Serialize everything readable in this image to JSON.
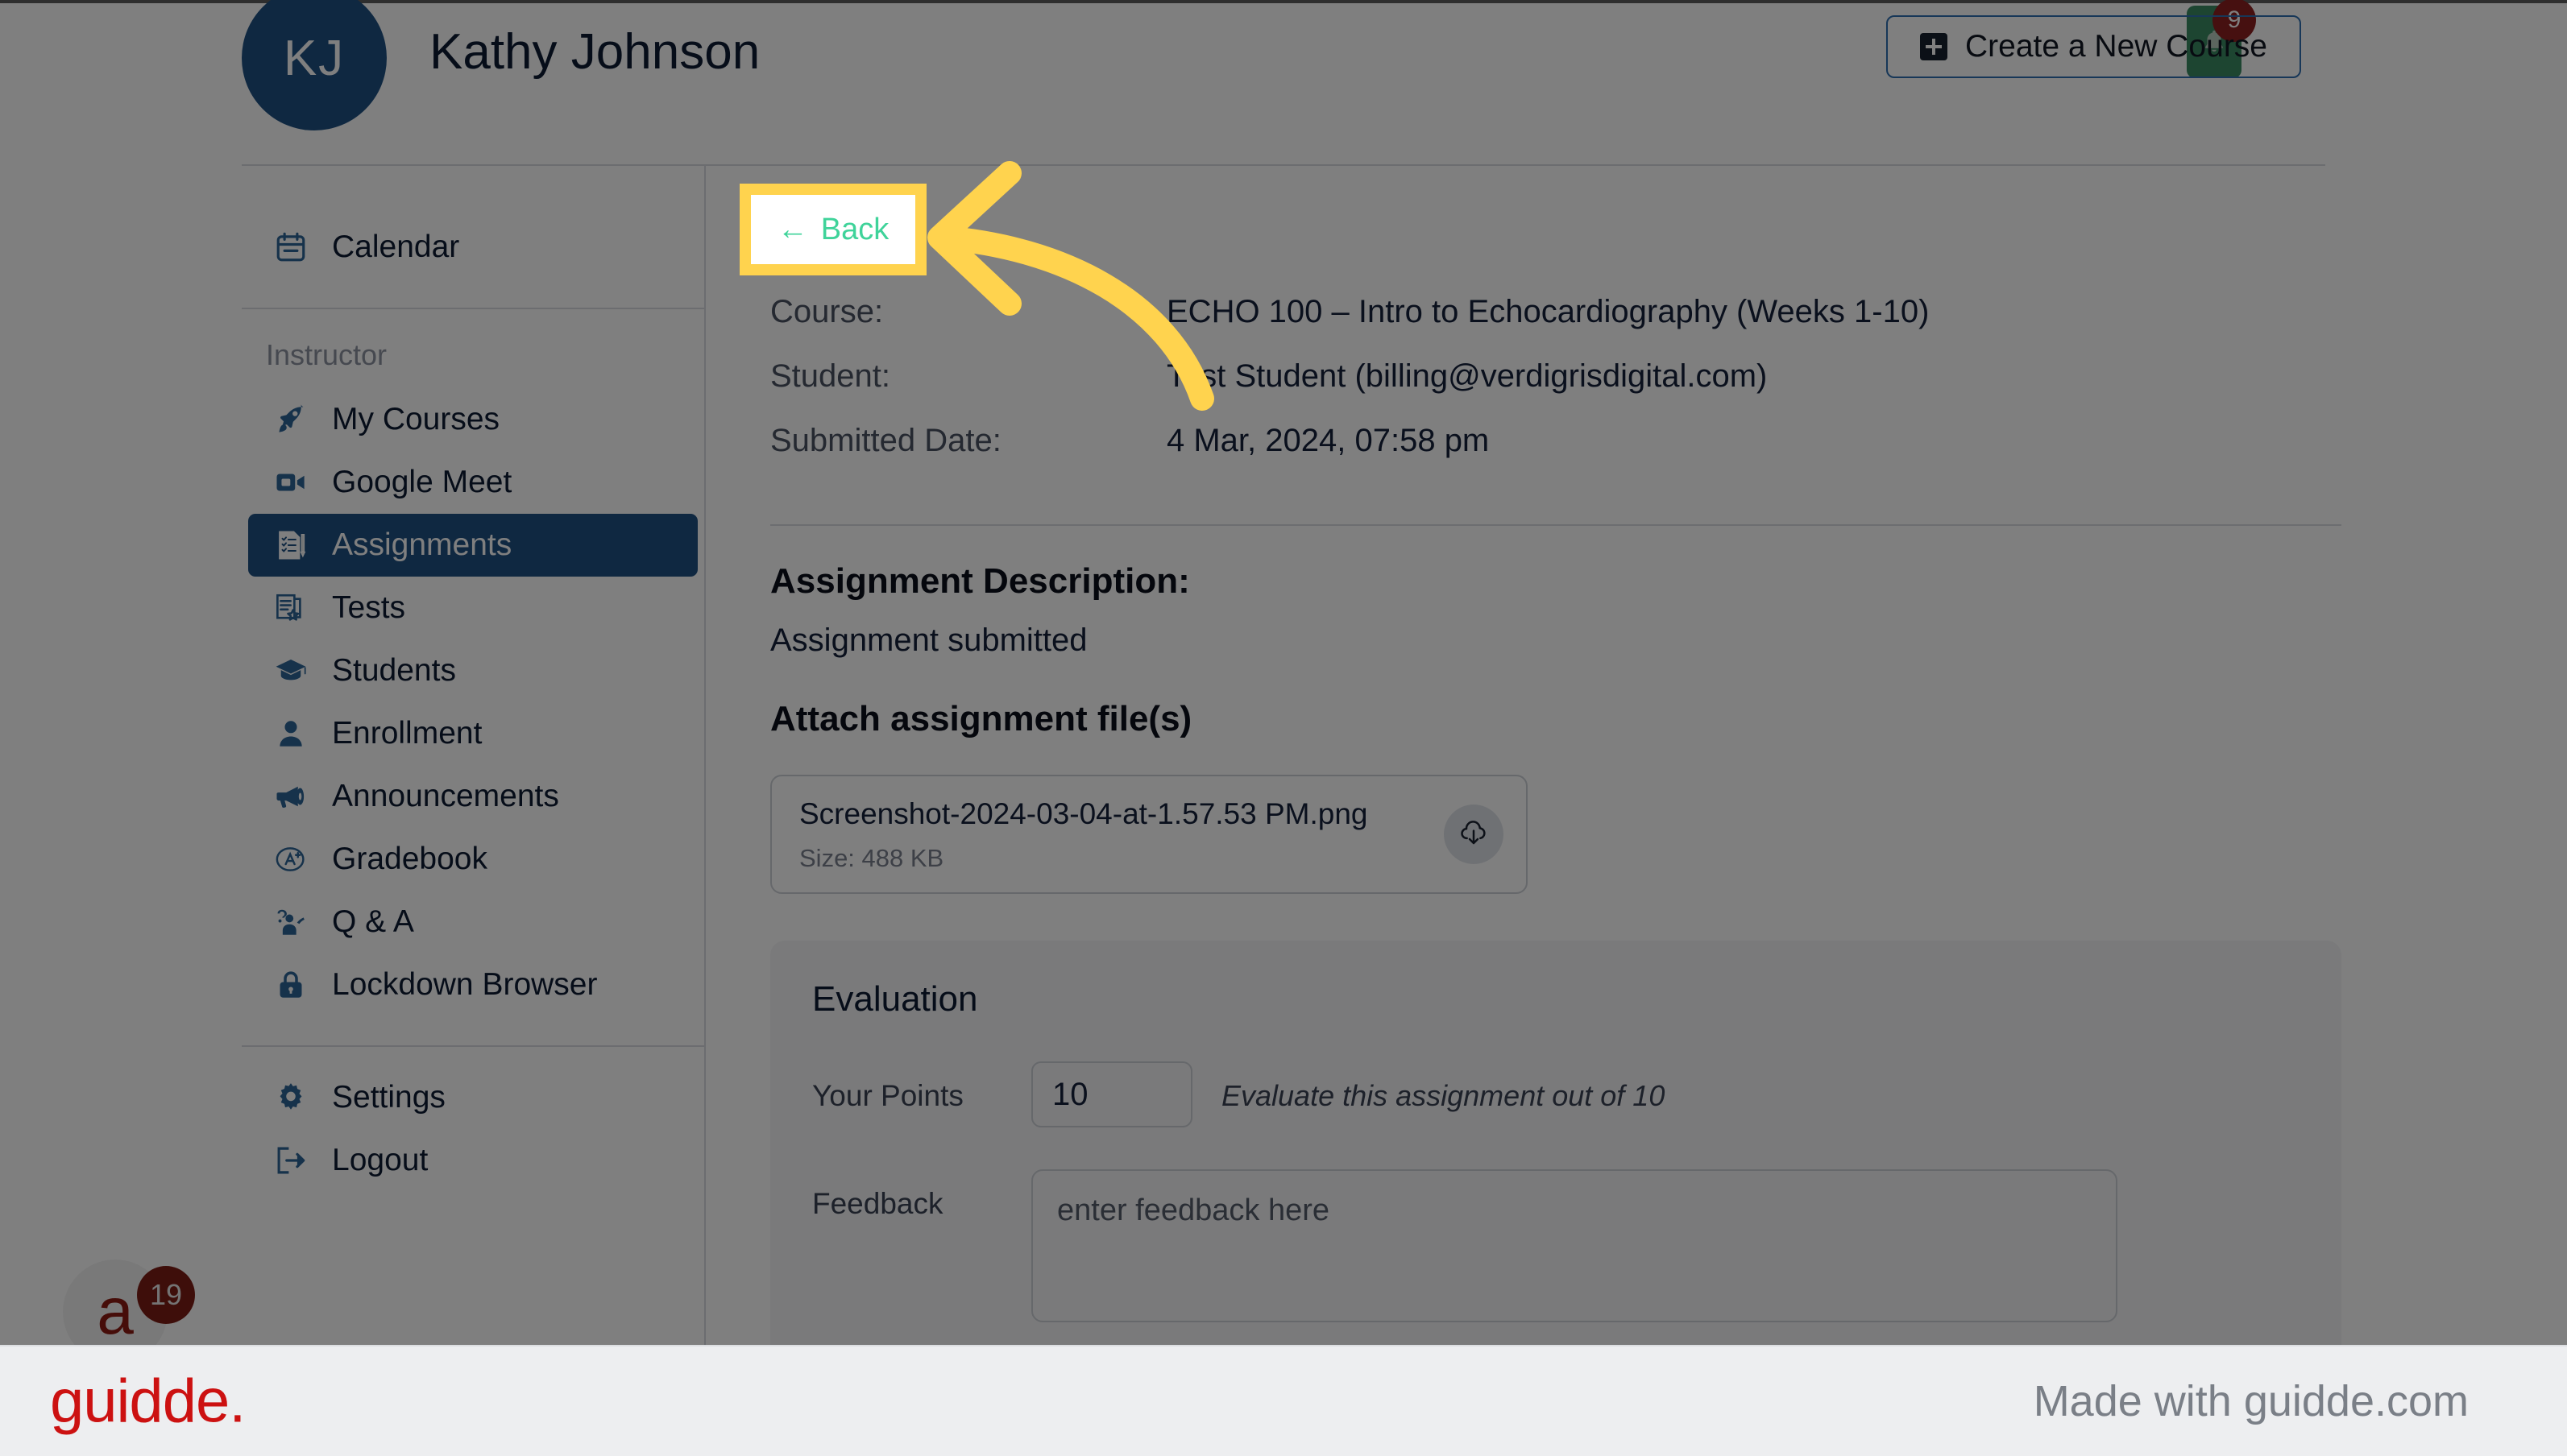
{
  "header": {
    "avatar_initials": "KJ",
    "user_name": "Kathy Johnson",
    "notification_count": "9",
    "notification_icon": "bell-icon",
    "create_course_label": "Create a New Course",
    "create_course_icon": "plus-square-icon"
  },
  "sidebar": {
    "group_label": "Instructor",
    "top_items": [
      {
        "label": "Calendar",
        "icon": "calendar-icon",
        "active": false
      }
    ],
    "items": [
      {
        "label": "My Courses",
        "icon": "rocket-icon",
        "active": false
      },
      {
        "label": "Google Meet",
        "icon": "video-camera-icon",
        "active": false
      },
      {
        "label": "Assignments",
        "icon": "checklist-document-icon",
        "active": true
      },
      {
        "label": "Tests",
        "icon": "test-paper-star-icon",
        "active": false
      },
      {
        "label": "Students",
        "icon": "graduation-cap-icon",
        "active": false
      },
      {
        "label": "Enrollment",
        "icon": "person-icon",
        "active": false
      },
      {
        "label": "Announcements",
        "icon": "megaphone-icon",
        "active": false
      },
      {
        "label": "Gradebook",
        "icon": "a-plus-grade-icon",
        "active": false
      },
      {
        "label": "Q & A",
        "icon": "raised-hand-question-icon",
        "active": false
      },
      {
        "label": "Lockdown Browser",
        "icon": "lock-icon",
        "active": false
      }
    ],
    "footer_items": [
      {
        "label": "Settings",
        "icon": "gear-icon",
        "active": false
      },
      {
        "label": "Logout",
        "icon": "logout-arrow-icon",
        "active": false
      }
    ]
  },
  "main": {
    "back_label": "Back",
    "back_icon": "arrow-left-icon",
    "meta": [
      {
        "label": "Course:",
        "value": "ECHO 100 – Intro to Echocardiography (Weeks 1-10)"
      },
      {
        "label": "Student:",
        "value": "Test Student (billing@verdigrisdigital.com)"
      },
      {
        "label": "Submitted Date:",
        "value": "4 Mar, 2024, 07:58 pm"
      }
    ],
    "description_title": "Assignment Description:",
    "description_text": "Assignment submitted",
    "attach_title": "Attach assignment file(s)",
    "file": {
      "name": "Screenshot-2024-03-04-at-1.57.53 PM.png",
      "size": "Size: 488 KB",
      "download_icon": "cloud-download-icon"
    },
    "evaluation": {
      "title": "Evaluation",
      "points_label": "Your Points",
      "points_value": "10",
      "points_hint": "Evaluate this assignment out of 10",
      "feedback_label": "Feedback",
      "feedback_value": "",
      "feedback_placeholder": "enter feedback here"
    }
  },
  "chat_widget": {
    "glyph": "a",
    "badge": "19"
  },
  "footer": {
    "logo": "guidde.",
    "made_with": "Made with guidde.com"
  },
  "colors": {
    "accent_blue": "#1f5183",
    "highlight_yellow": "#ffd34e",
    "back_green": "#3fd39a",
    "notification_green": "#3a8a62",
    "badge_red": "#8c2020",
    "guidde_red": "#cc1111"
  }
}
